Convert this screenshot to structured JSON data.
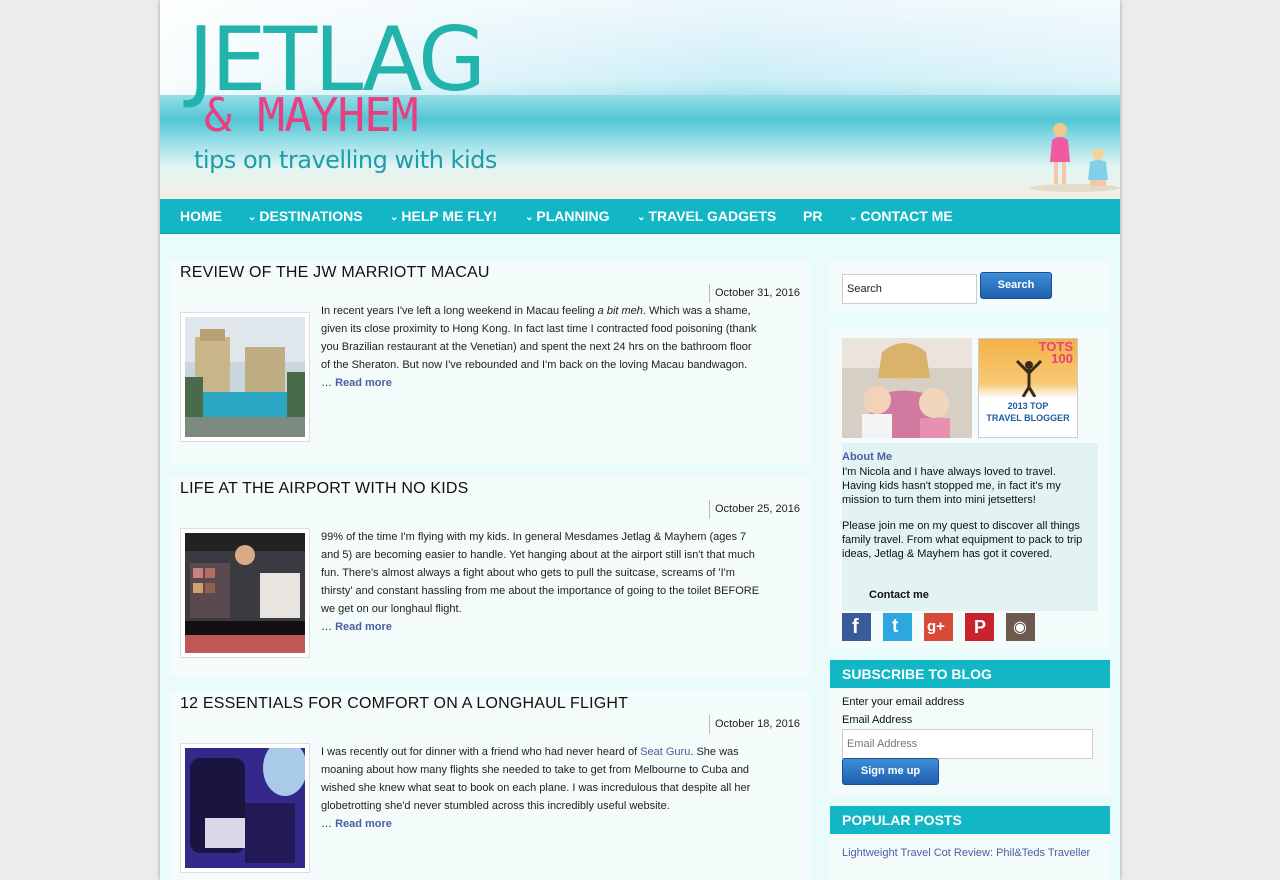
{
  "header": {
    "logo_main": "JETLAG",
    "logo_sub": "& MAYHEM",
    "tagline": "tips on travelling with kids"
  },
  "nav": {
    "items": [
      {
        "label": "HOME"
      },
      {
        "label": "DESTINATIONS"
      },
      {
        "label": "HELP ME FLY!"
      },
      {
        "label": "PLANNING"
      },
      {
        "label": "TRAVEL GADGETS"
      },
      {
        "label": "PR"
      },
      {
        "label": "CONTACT ME"
      }
    ]
  },
  "posts": [
    {
      "title": "REVIEW OF THE JW MARRIOTT MACAU",
      "date": "October 31, 2016",
      "lines": [
        {
          "pre": "In recent years I've left a long weekend in Macau feeling ",
          "em": "a bit meh",
          "post": ".  Which was a shame,"
        },
        "given its close proximity to Hong Kong. In fact last time I contracted food poisoning (thank",
        "you Brazilian restaurant at the Venetian) and spent the next 24 hrs on the bathroom floor",
        "of the Sheraton.  But now I've rebounded and I'm back on the loving Macau bandwagon."
      ],
      "ellipsis": "…",
      "read_more": "Read more"
    },
    {
      "title": "LIFE AT THE AIRPORT WITH NO KIDS",
      "date": "October 25, 2016",
      "lines": [
        "99% of the time I'm flying with my kids.  In general Mesdames Jetlag & Mayhem (ages 7",
        "and 5) are becoming easier to handle. Yet hanging about at the airport still isn't that much",
        "fun.  There's almost always a fight about who gets to pull the suitcase, screams of 'I'm",
        "thirsty' and constant hassling from me about the importance of going to the toilet BEFORE",
        "we get on our longhaul flight."
      ],
      "ellipsis": "…",
      "read_more": "Read more"
    },
    {
      "title": "12 ESSENTIALS FOR COMFORT ON A LONGHAUL FLIGHT",
      "date": "October 18, 2016",
      "lines": [
        {
          "pre": "I was recently out for dinner with a friend who had never heard of ",
          "link": "Seat Guru",
          "post": ". She was"
        },
        "moaning about how many flights she needed to take to get from Melbourne to Cuba and",
        "wished she knew what seat to book on each plane.  I was incredulous that despite all her",
        "globetrotting she'd never stumbled across this incredibly useful website."
      ],
      "ellipsis": "…",
      "read_more": "Read more"
    }
  ],
  "sidebar": {
    "search": {
      "value": "Search",
      "button": "Search"
    },
    "badge": {
      "top": "TOTS",
      "num": "100",
      "line1": "2013 TOP",
      "line2": "TRAVEL BLOGGER"
    },
    "about": {
      "heading": "About Me",
      "para1": "I'm Nicola and I have always loved to travel. Having kids hasn't stopped me, in fact it's my mission to turn them into mini jetsetters!",
      "para2": "Please join me on my quest to discover all things family travel. From what equipment to pack to trip ideas, Jetlag & Mayhem has got it covered.",
      "contact": "Contact me"
    },
    "social": [
      {
        "icon": "facebook-icon",
        "glyph": "f",
        "color": "#3b5a9a"
      },
      {
        "icon": "twitter-icon",
        "glyph": "t",
        "color": "#2ca7e0"
      },
      {
        "icon": "google-plus-icon",
        "glyph": "g+",
        "color": "#d84a38"
      },
      {
        "icon": "pinterest-icon",
        "glyph": "P",
        "color": "#c8232c"
      },
      {
        "icon": "instagram-icon",
        "glyph": "◉",
        "color": "#6b5a4d"
      }
    ],
    "subscribe": {
      "title": "SUBSCRIBE TO BLOG",
      "prompt": "Enter your email address",
      "label": "Email Address",
      "placeholder": "Email Address",
      "button": "Sign me up"
    },
    "popular": {
      "title": "POPULAR POSTS",
      "items": [
        "Lightweight Travel Cot Review: Phil&Teds Traveller"
      ]
    }
  }
}
